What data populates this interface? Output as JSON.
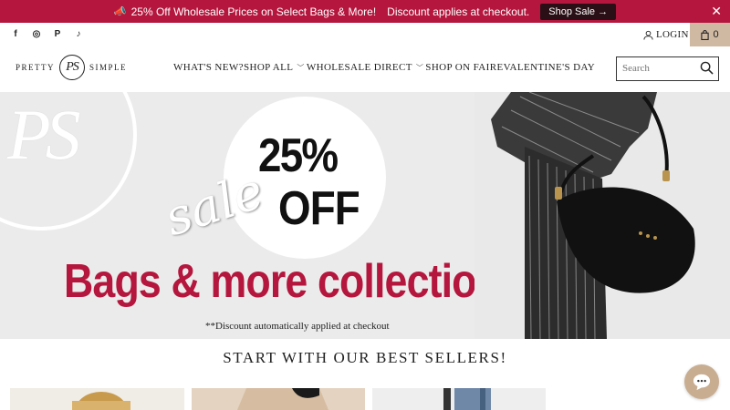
{
  "announcement": {
    "emoji": "📣",
    "message": "25% Off Wholesale Prices on Select Bags & More!",
    "submessage": "Discount applies at checkout.",
    "cta_label": "Shop Sale →",
    "close_glyph": "✕"
  },
  "socials": [
    {
      "icon": "facebook-icon",
      "glyph": "f"
    },
    {
      "icon": "instagram-icon",
      "glyph": "◎"
    },
    {
      "icon": "pinterest-icon",
      "glyph": "P"
    },
    {
      "icon": "tiktok-icon",
      "glyph": "♪"
    }
  ],
  "account": {
    "login_label": "LOGIN"
  },
  "cart": {
    "count": "0"
  },
  "brand": {
    "word1": "PRETTY",
    "mark": "PS",
    "word2": "SIMPLE"
  },
  "nav": [
    {
      "label": "WHAT'S NEW?",
      "dropdown": false
    },
    {
      "label": "SHOP ALL",
      "dropdown": true
    },
    {
      "label": "WHOLESALE DIRECT",
      "dropdown": true
    },
    {
      "label": "SHOP ON FAIRE",
      "dropdown": false
    },
    {
      "label": "VALENTINE'S DAY",
      "dropdown": false
    }
  ],
  "search": {
    "placeholder": "Search"
  },
  "hero": {
    "logo_text": "PS",
    "script": "sale",
    "percent": "25%",
    "off": "OFF",
    "headline": "Bags & more collection",
    "note": "**Discount automatically applied at checkout"
  },
  "best_sellers": {
    "title": "START WITH OUR BEST SELLERS!"
  },
  "colors": {
    "accent": "#b5163d",
    "cart_bg": "#cfb9a3",
    "hero_bg": "#ebebeb"
  }
}
